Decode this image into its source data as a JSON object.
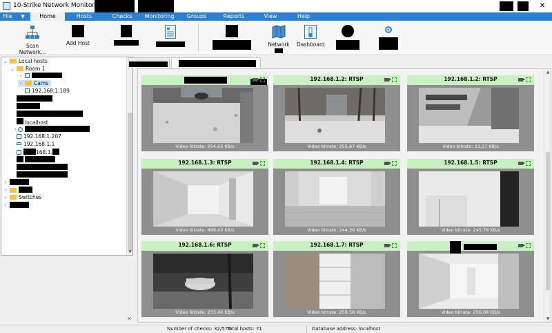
{
  "window": {
    "title": "10-Strike Network Monitor Pro",
    "controls": [
      "—",
      "□",
      "✕"
    ]
  },
  "menu": {
    "file": "File",
    "caret": "▼",
    "tabs": [
      "Home",
      "Hosts",
      "Checks",
      "Monitoring",
      "Groups",
      "Reports",
      "View",
      "Help"
    ],
    "active": "Home"
  },
  "ribbon": {
    "scan": "Scan Network...",
    "add_host": "Add Host",
    "network": "Network",
    "dashboard": "Dashboard"
  },
  "tree": {
    "local_hosts": "Local hosts",
    "room1": "Room 1",
    "cams": "Cams",
    "ip_189": "192.168.1.189",
    "localhost": "localhost",
    "ip_207": "192.168.1.207",
    "ip_1": "192.168.1.1",
    "ip_partial": "168.1.",
    "switches": "Switches"
  },
  "cameras": [
    {
      "name": "",
      "bitrate": "Video bitrate: 254,63 KB/s",
      "scene": "snowyard"
    },
    {
      "name": "192.168.1.2: RTSP",
      "bitrate": "Video bitrate: 255,67 KB/s",
      "scene": "trees"
    },
    {
      "name": "192.168.1.2: RTSP",
      "bitrate": "Video bitrate: 23,17 KB/s",
      "scene": "building"
    },
    {
      "name": "192.168.1.3: RTSP",
      "bitrate": "Video bitrate: 499,43 KB/s",
      "scene": "corridor"
    },
    {
      "name": "192.168.1.4: RTSP",
      "bitrate": "Video bitrate: 244,36 KB/s",
      "scene": "lobby"
    },
    {
      "name": "192.168.1.5: RTSP",
      "bitrate": "Video bitrate: 245,76 KB/s",
      "scene": "stairs"
    },
    {
      "name": "192.168.1.6: RTSP",
      "bitrate": "Video bitrate: 233,46 KB/s",
      "scene": "night"
    },
    {
      "name": "192.168.1.7: RTSP",
      "bitrate": "Video bitrate: 258,58 KB/s",
      "scene": "stairwell"
    },
    {
      "name": "",
      "bitrate": "Video bitrate: 256,08 KB/s",
      "scene": "hall"
    }
  ],
  "status": {
    "checks": "Number of checks: 32/576",
    "hosts": "Total hosts: 71",
    "db": "Database address: localhost"
  },
  "colors": {
    "accent": "#2b7fd4",
    "tile_header": "#c9f0c0",
    "tile_bg": "#8f8f8f"
  }
}
